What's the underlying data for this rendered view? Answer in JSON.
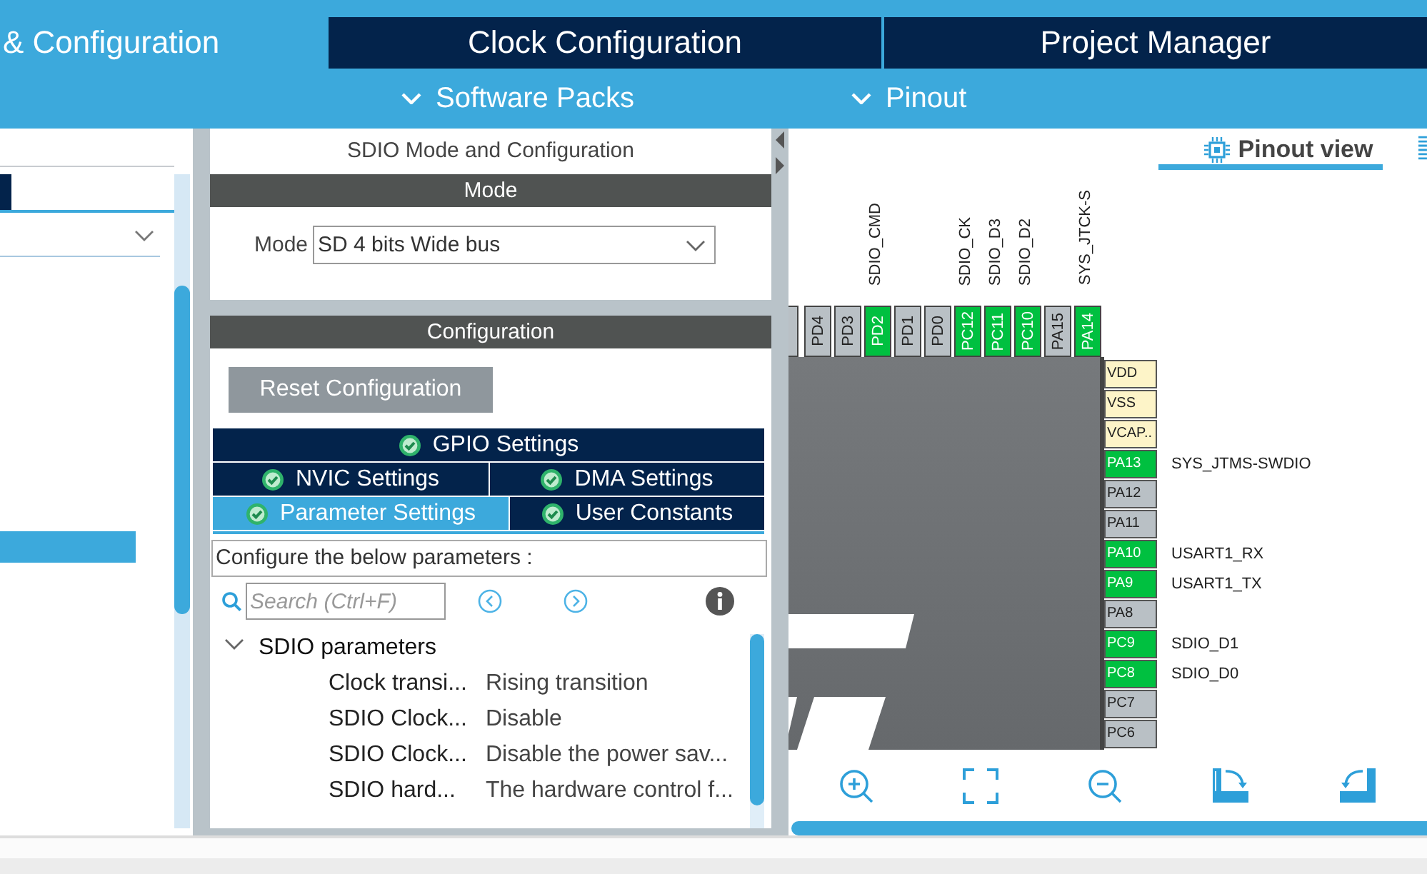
{
  "main_tabs": [
    {
      "label": "& Configuration",
      "selected": true
    },
    {
      "label": "Clock Configuration",
      "selected": false
    },
    {
      "label": "Project Manager",
      "selected": false
    }
  ],
  "sub_menus": [
    {
      "label": "Software Packs"
    },
    {
      "label": "Pinout"
    }
  ],
  "mode_panel": {
    "title": "SDIO Mode and Configuration",
    "mode_header": "Mode",
    "mode_label": "Mode",
    "mode_value": "SD 4 bits Wide bus"
  },
  "configuration": {
    "header": "Configuration",
    "reset_button": "Reset Configuration",
    "tab_rows": [
      {
        "tabs": [
          {
            "label": "GPIO Settings",
            "selected": false
          }
        ]
      },
      {
        "tabs": [
          {
            "label": "NVIC Settings",
            "selected": false
          },
          {
            "label": "DMA Settings",
            "selected": false
          }
        ]
      },
      {
        "tabs": [
          {
            "label": "Parameter Settings",
            "selected": true
          },
          {
            "label": "User Constants",
            "selected": false
          }
        ]
      }
    ],
    "description": "Configure the below parameters :",
    "search": {
      "placeholder": "Search (Ctrl+F)"
    },
    "tree": [
      {
        "label": "SDIO parameters",
        "expanded": true,
        "children": [
          {
            "name": "Clock transi...",
            "value": "Rising transition"
          },
          {
            "name": "SDIO Clock...",
            "value": "Disable"
          },
          {
            "name": "SDIO Clock...",
            "value": "Disable the power sav..."
          },
          {
            "name": "SDIO hard...",
            "value": "The hardware control f..."
          }
        ]
      }
    ]
  },
  "pinout": {
    "view_tab": {
      "label": "Pinout view",
      "selected": true
    },
    "top_pins": [
      {
        "name": "PD4",
        "kind": "free"
      },
      {
        "name": "PD3",
        "kind": "free"
      },
      {
        "name": "PD2",
        "kind": "assigned",
        "signal": "SDIO_CMD"
      },
      {
        "name": "PD1",
        "kind": "free"
      },
      {
        "name": "PD0",
        "kind": "free"
      },
      {
        "name": "PC12",
        "kind": "assigned",
        "signal": "SDIO_CK"
      },
      {
        "name": "PC11",
        "kind": "assigned",
        "signal": "SDIO_D3"
      },
      {
        "name": "PC10",
        "kind": "assigned",
        "signal": "SDIO_D2"
      },
      {
        "name": "PA15",
        "kind": "free"
      },
      {
        "name": "PA14",
        "kind": "assigned",
        "signal": "SYS_JTCK-S"
      }
    ],
    "right_pins": [
      {
        "name": "VDD",
        "kind": "power"
      },
      {
        "name": "VSS",
        "kind": "power"
      },
      {
        "name": "VCAP..",
        "kind": "power"
      },
      {
        "name": "PA13",
        "kind": "assigned",
        "signal": "SYS_JTMS-SWDIO"
      },
      {
        "name": "PA12",
        "kind": "free"
      },
      {
        "name": "PA11",
        "kind": "free"
      },
      {
        "name": "PA10",
        "kind": "assigned",
        "signal": "USART1_RX"
      },
      {
        "name": "PA9",
        "kind": "assigned",
        "signal": "USART1_TX"
      },
      {
        "name": "PA8",
        "kind": "free"
      },
      {
        "name": "PC9",
        "kind": "assigned",
        "signal": "SDIO_D1"
      },
      {
        "name": "PC8",
        "kind": "assigned",
        "signal": "SDIO_D0"
      },
      {
        "name": "PC7",
        "kind": "free"
      },
      {
        "name": "PC6",
        "kind": "free"
      }
    ]
  }
}
